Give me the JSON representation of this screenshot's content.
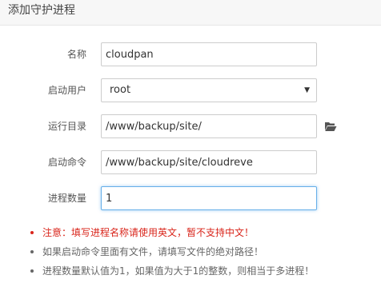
{
  "dialog": {
    "title": "添加守护进程"
  },
  "form": {
    "name": {
      "label": "名称",
      "value": "cloudpan"
    },
    "user": {
      "label": "启动用户",
      "selected": "root"
    },
    "directory": {
      "label": "运行目录",
      "value": "/www/backup/site/"
    },
    "command": {
      "label": "启动命令",
      "value": "/www/backup/site/cloudreve"
    },
    "process_count": {
      "label": "进程数量",
      "value": "1"
    }
  },
  "icons": {
    "folder": "folder-open-icon",
    "select_arrow": "caret-down-icon"
  },
  "notes": [
    "注意：填写进程名称请使用英文，暂不支持中文！",
    "如果启动命令里面有文件，请填写文件的绝对路径！",
    "进程数量默认值为1，如果值为大于1的整数，则相当于多进程！"
  ],
  "colors": {
    "warning": "#d9251b",
    "focus_border": "#66afe9",
    "header_bg": "#f7f7f7"
  }
}
